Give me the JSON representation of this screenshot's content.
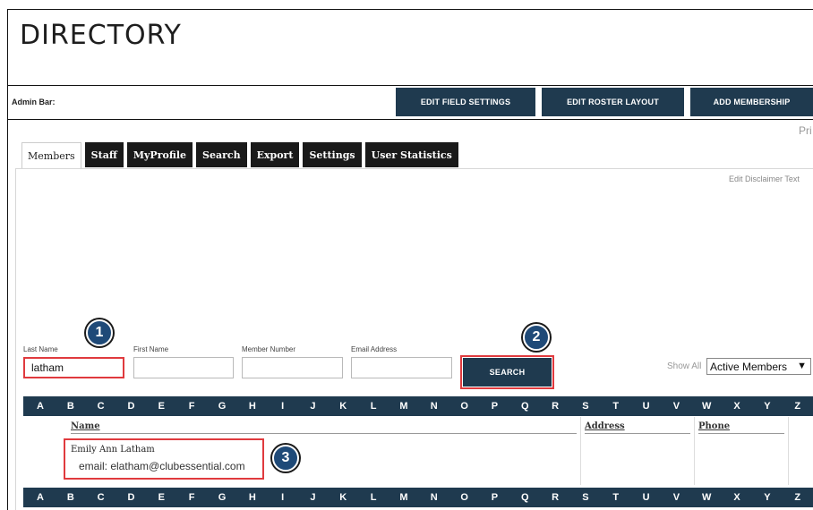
{
  "page": {
    "title": "DIRECTORY"
  },
  "admin_bar": {
    "label": "Admin Bar:",
    "buttons": [
      "EDIT FIELD SETTINGS",
      "EDIT ROSTER LAYOUT",
      "ADD MEMBERSHIP"
    ]
  },
  "top_right_text": "Pri",
  "tabs": [
    "Members",
    "Staff",
    "MyProfile",
    "Search",
    "Export",
    "Settings",
    "User Statistics"
  ],
  "active_tab": "Members",
  "disclaimer_link": "Edit Disclaimer Text",
  "search": {
    "last_name": {
      "label": "Last Name",
      "value": "latham",
      "placeholder": ""
    },
    "first_name": {
      "label": "First Name",
      "value": "",
      "placeholder": ""
    },
    "member_number": {
      "label": "Member Number",
      "value": "",
      "placeholder": ""
    },
    "email": {
      "label": "Email Address",
      "value": "",
      "placeholder": ""
    },
    "button": "SEARCH"
  },
  "filter": {
    "show_all": "Show All",
    "selected": "Active Members"
  },
  "alphabet": [
    "A",
    "B",
    "C",
    "D",
    "E",
    "F",
    "G",
    "H",
    "I",
    "J",
    "K",
    "L",
    "M",
    "N",
    "O",
    "P",
    "Q",
    "R",
    "S",
    "T",
    "U",
    "V",
    "W",
    "X",
    "Y",
    "Z"
  ],
  "results": {
    "columns": {
      "name": "Name",
      "address": "Address",
      "phone": "Phone"
    },
    "rows": [
      {
        "name": "Emily Ann Latham",
        "email": "email: elatham@clubessential.com"
      }
    ]
  },
  "callouts": [
    "1",
    "2",
    "3"
  ],
  "colors": {
    "accent": "#1f3a4f",
    "highlight": "#e03a3e",
    "callout": "#1f4a78"
  }
}
